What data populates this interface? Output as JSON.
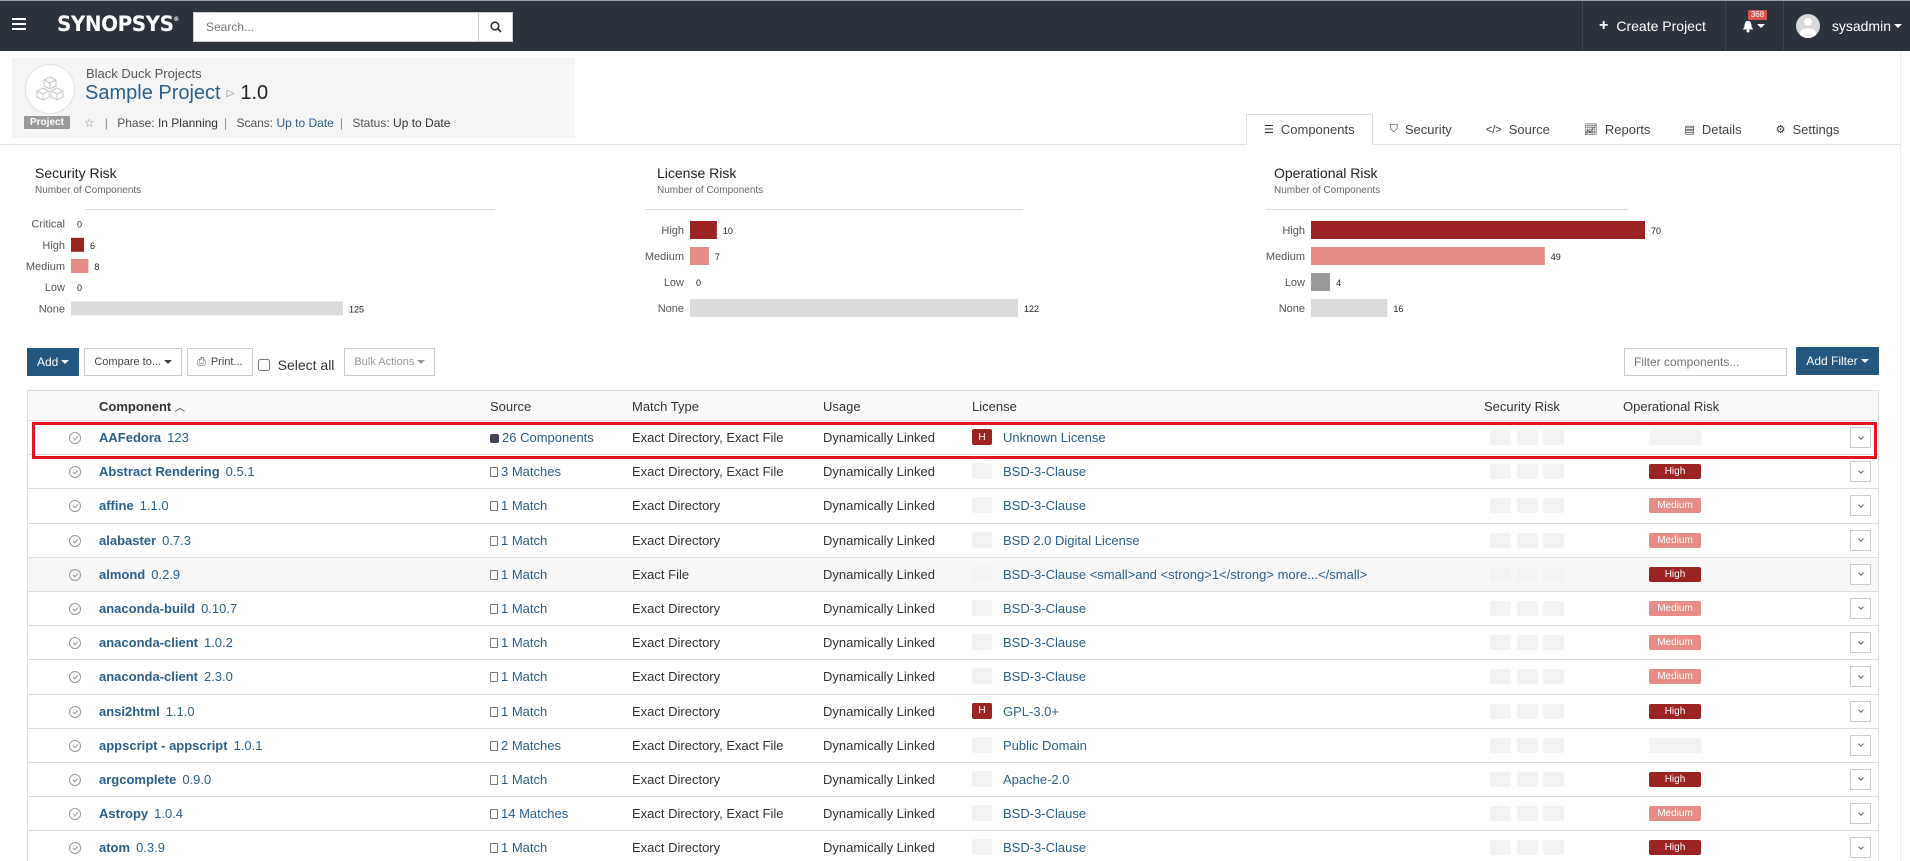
{
  "nav": {
    "menu_icon": "hamburger-icon",
    "logo": "SYNOPSYS",
    "search_placeholder": "Search...",
    "search_icon": "search-icon",
    "create_project": "Create Project",
    "notifications_count": "368",
    "username": "sysadmin"
  },
  "project": {
    "icon": "cubes-icon",
    "breadcrumb": "Black Duck Projects",
    "name": "Sample Project",
    "version": "1.0",
    "badge": "Project",
    "phase_label": "Phase:",
    "phase": "In Planning",
    "scans_label": "Scans:",
    "scans": "Up to Date",
    "status_label": "Status:",
    "status": "Up to Date"
  },
  "tabs": [
    {
      "label": "Components",
      "icon": "list-icon",
      "active": true
    },
    {
      "label": "Security",
      "icon": "shield-icon",
      "active": false
    },
    {
      "label": "Source",
      "icon": "code-icon",
      "active": false
    },
    {
      "label": "Reports",
      "icon": "chart-icon",
      "active": false
    },
    {
      "label": "Details",
      "icon": "details-icon",
      "active": false
    },
    {
      "label": "Settings",
      "icon": "gear-icon",
      "active": false
    }
  ],
  "colors": {
    "high": "#9b2423",
    "medium": "#e88c87",
    "low": "#9a9a9a",
    "none": "#dcdcdc",
    "accent": "#24577f",
    "link": "#2c5f8a",
    "highlight": "#e0151f"
  },
  "chart_data": [
    {
      "type": "bar",
      "orientation": "horizontal",
      "title": "Security Risk",
      "subtitle": "Number of Components",
      "categories": [
        "Critical",
        "High",
        "Medium",
        "Low",
        "None"
      ],
      "values": [
        0,
        6,
        8,
        0,
        125
      ],
      "colors": [
        "#9b2423",
        "#9b2423",
        "#e88c87",
        "#9a9a9a",
        "#dcdcdc"
      ],
      "xlim": [
        0,
        125
      ]
    },
    {
      "type": "bar",
      "orientation": "horizontal",
      "title": "License Risk",
      "subtitle": "Number of Components",
      "categories": [
        "High",
        "Medium",
        "Low",
        "None"
      ],
      "values": [
        10,
        7,
        0,
        122
      ],
      "colors": [
        "#9b2423",
        "#e88c87",
        "#9a9a9a",
        "#dcdcdc"
      ],
      "xlim": [
        0,
        122
      ]
    },
    {
      "type": "bar",
      "orientation": "horizontal",
      "title": "Operational Risk",
      "subtitle": "Number of Components",
      "categories": [
        "High",
        "Medium",
        "Low",
        "None"
      ],
      "values": [
        70,
        49,
        4,
        16
      ],
      "colors": [
        "#9b2423",
        "#e88c87",
        "#9a9a9a",
        "#dcdcdc"
      ],
      "xlim": [
        0,
        70
      ]
    }
  ],
  "toolbar": {
    "add": "Add",
    "compare": "Compare to...",
    "print": "Print...",
    "select_all": "Select all",
    "bulk_actions": "Bulk Actions",
    "filter_placeholder": "Filter components...",
    "add_filter": "Add Filter"
  },
  "table": {
    "columns": [
      "Component",
      "Source",
      "Match Type",
      "Usage",
      "License",
      "Security Risk",
      "Operational Risk"
    ],
    "rows": [
      {
        "name": "AAFedora",
        "version": "123",
        "source": "26 Components",
        "source_icon": "cube",
        "match": "Exact Directory, Exact File",
        "usage": "Dynamically Linked",
        "license_risk": "H",
        "license": "Unknown License",
        "op_risk": "",
        "highlighted": true
      },
      {
        "name": "Abstract Rendering",
        "version": "0.5.1",
        "source": "3 Matches",
        "source_icon": "file",
        "match": "Exact Directory, Exact File",
        "usage": "Dynamically Linked",
        "license_risk": "",
        "license": "BSD-3-Clause",
        "op_risk": "High"
      },
      {
        "name": "affine",
        "version": "1.1.0",
        "source": "1 Match",
        "source_icon": "file",
        "match": "Exact Directory",
        "usage": "Dynamically Linked",
        "license_risk": "",
        "license": "BSD-3-Clause",
        "op_risk": "Medium"
      },
      {
        "name": "alabaster",
        "version": "0.7.3",
        "source": "1 Match",
        "source_icon": "file",
        "match": "Exact Directory",
        "usage": "Dynamically Linked",
        "license_risk": "",
        "license": "BSD 2.0 Digital License",
        "op_risk": "Medium"
      },
      {
        "name": "almond",
        "version": "0.2.9",
        "source": "1 Match",
        "source_icon": "file",
        "match": "Exact File",
        "usage": "Dynamically Linked",
        "license_risk": "",
        "license": "BSD-3-Clause <small>and <strong>1</strong> more...</small>",
        "op_risk": "High",
        "hover": true
      },
      {
        "name": "anaconda-build",
        "version": "0.10.7",
        "source": "1 Match",
        "source_icon": "file",
        "match": "Exact Directory",
        "usage": "Dynamically Linked",
        "license_risk": "",
        "license": "BSD-3-Clause",
        "op_risk": "Medium"
      },
      {
        "name": "anaconda-client",
        "version": "1.0.2",
        "source": "1 Match",
        "source_icon": "file",
        "match": "Exact Directory",
        "usage": "Dynamically Linked",
        "license_risk": "",
        "license": "BSD-3-Clause",
        "op_risk": "Medium"
      },
      {
        "name": "anaconda-client",
        "version": "2.3.0",
        "source": "1 Match",
        "source_icon": "file",
        "match": "Exact Directory",
        "usage": "Dynamically Linked",
        "license_risk": "",
        "license": "BSD-3-Clause",
        "op_risk": "Medium"
      },
      {
        "name": "ansi2html",
        "version": "1.1.0",
        "source": "1 Match",
        "source_icon": "file",
        "match": "Exact Directory",
        "usage": "Dynamically Linked",
        "license_risk": "H",
        "license": "GPL-3.0+",
        "op_risk": "High"
      },
      {
        "name": "appscript - appscript",
        "version": "1.0.1",
        "source": "2 Matches",
        "source_icon": "file",
        "match": "Exact Directory, Exact File",
        "usage": "Dynamically Linked",
        "license_risk": "",
        "license": "Public Domain",
        "op_risk": ""
      },
      {
        "name": "argcomplete",
        "version": "0.9.0",
        "source": "1 Match",
        "source_icon": "file",
        "match": "Exact Directory",
        "usage": "Dynamically Linked",
        "license_risk": "",
        "license": "Apache-2.0",
        "op_risk": "High"
      },
      {
        "name": "Astropy",
        "version": "1.0.4",
        "source": "14 Matches",
        "source_icon": "file",
        "match": "Exact Directory, Exact File",
        "usage": "Dynamically Linked",
        "license_risk": "",
        "license": "BSD-3-Clause",
        "op_risk": "Medium"
      },
      {
        "name": "atom",
        "version": "0.3.9",
        "source": "1 Match",
        "source_icon": "file",
        "match": "Exact Directory",
        "usage": "Dynamically Linked",
        "license_risk": "",
        "license": "BSD-3-Clause",
        "op_risk": "High"
      }
    ]
  }
}
